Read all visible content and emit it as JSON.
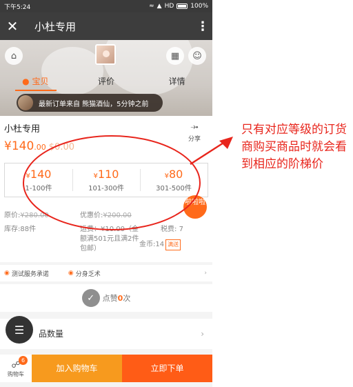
{
  "status_bar": {
    "time": "下午5:24",
    "network": "HD",
    "battery": "100%"
  },
  "title_bar": {
    "close_icon": "close-icon",
    "title": "小杜专用",
    "more_icon": "more-vertical-icon"
  },
  "hero": {
    "tabs": [
      {
        "label": "宝贝"
      },
      {
        "label": "评价"
      },
      {
        "label": "详情"
      }
    ],
    "notice_text": "最新订单来自 熊猫酒仙，5分钟之前"
  },
  "product": {
    "name": "小杜专用",
    "share_label": "分享",
    "price_symbol": "¥",
    "price_main": "140",
    "price_decimal": ".00",
    "alt_price": "$0.00",
    "tiers": [
      {
        "price": "140",
        "range": "1-100件"
      },
      {
        "price": "110",
        "range": "101-300件"
      },
      {
        "price": "80",
        "range": "301-500件"
      }
    ],
    "badge": "啦啦啦",
    "original_price_label": "原价:",
    "original_price": "¥280.00",
    "promo_label": "优惠价:",
    "promo_price": "¥200.00",
    "stock_label": "库存:",
    "stock": "88件",
    "shipping": "运费：¥10.00（金额满501元且满2件包邮）",
    "tax_label": "税费:",
    "tax": "7",
    "coin_label": "金币:",
    "coin": "14",
    "coin_tag": "满送"
  },
  "services": {
    "item1": "测试服务承诺",
    "item2": "分身乏术"
  },
  "like": {
    "label": "点赞",
    "count": "0",
    "suffix": "次"
  },
  "quantity_row": {
    "label": "品数量"
  },
  "bottom_bar": {
    "cart_count": "6",
    "cart_label": "购物车",
    "add_to_cart": "加入购物车",
    "buy_now": "立即下单"
  },
  "annotation": {
    "text": "只有对应等级的订货商购买商品时就会看到相应的阶梯价"
  },
  "colors": {
    "accent": "#ff6a1a",
    "annotation_red": "#e8251c",
    "add_cart_bg": "#f79a1e",
    "buy_now_bg": "#ff5c16"
  }
}
